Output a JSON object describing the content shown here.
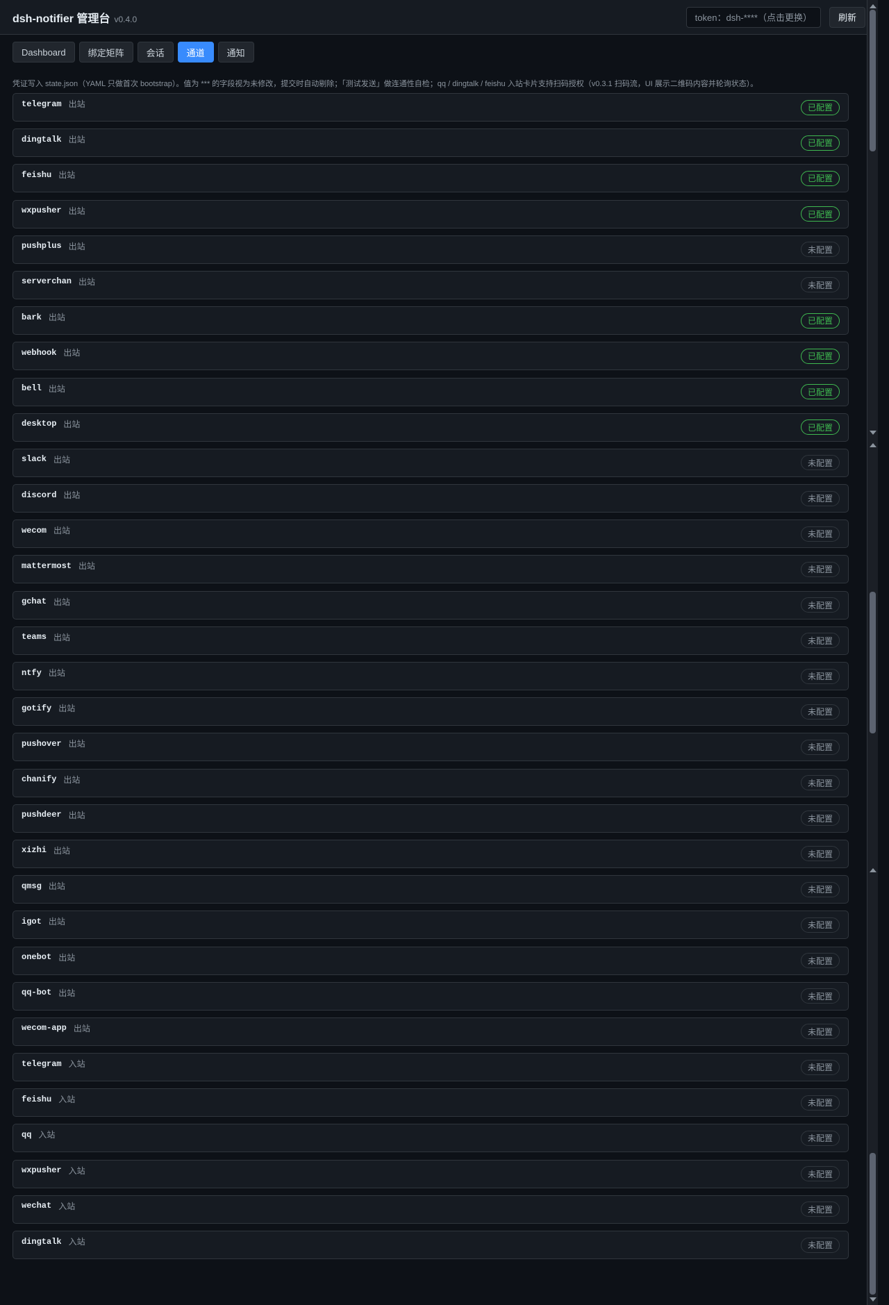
{
  "header": {
    "title": "dsh-notifier 管理台",
    "version": "v0.4.0",
    "token_label": "token：dsh-****（点击更换）",
    "refresh_label": "刷新"
  },
  "tabs": [
    {
      "label": "Dashboard",
      "active": false
    },
    {
      "label": "绑定矩阵",
      "active": false
    },
    {
      "label": "会话",
      "active": false
    },
    {
      "label": "通道",
      "active": true
    },
    {
      "label": "通知",
      "active": false
    }
  ],
  "note": "凭证写入 state.json（YAML 只做首次 bootstrap）。值为 *** 的字段视为未修改，提交时自动剔除；「测试发送」做连通性自检；qq / dingtalk / feishu 入站卡片支持扫码授权（v0.3.1 扫码流，UI 展示二维码内容并轮询状态）。",
  "status_labels": {
    "configured": "已配置",
    "not_configured": "未配置"
  },
  "colors": {
    "accent": "#388bfd",
    "configured": "#3fb950",
    "background": "#0d1117"
  },
  "channels": [
    {
      "name": "telegram",
      "direction": "出站",
      "configured": true
    },
    {
      "name": "dingtalk",
      "direction": "出站",
      "configured": true
    },
    {
      "name": "feishu",
      "direction": "出站",
      "configured": true
    },
    {
      "name": "wxpusher",
      "direction": "出站",
      "configured": true
    },
    {
      "name": "pushplus",
      "direction": "出站",
      "configured": false
    },
    {
      "name": "serverchan",
      "direction": "出站",
      "configured": false
    },
    {
      "name": "bark",
      "direction": "出站",
      "configured": true
    },
    {
      "name": "webhook",
      "direction": "出站",
      "configured": true
    },
    {
      "name": "bell",
      "direction": "出站",
      "configured": true
    },
    {
      "name": "desktop",
      "direction": "出站",
      "configured": true
    },
    {
      "name": "slack",
      "direction": "出站",
      "configured": false
    },
    {
      "name": "discord",
      "direction": "出站",
      "configured": false
    },
    {
      "name": "wecom",
      "direction": "出站",
      "configured": false
    },
    {
      "name": "mattermost",
      "direction": "出站",
      "configured": false
    },
    {
      "name": "gchat",
      "direction": "出站",
      "configured": false
    },
    {
      "name": "teams",
      "direction": "出站",
      "configured": false
    },
    {
      "name": "ntfy",
      "direction": "出站",
      "configured": false
    },
    {
      "name": "gotify",
      "direction": "出站",
      "configured": false
    },
    {
      "name": "pushover",
      "direction": "出站",
      "configured": false
    },
    {
      "name": "chanify",
      "direction": "出站",
      "configured": false
    },
    {
      "name": "pushdeer",
      "direction": "出站",
      "configured": false
    },
    {
      "name": "xizhi",
      "direction": "出站",
      "configured": false
    },
    {
      "name": "qmsg",
      "direction": "出站",
      "configured": false
    },
    {
      "name": "igot",
      "direction": "出站",
      "configured": false
    },
    {
      "name": "onebot",
      "direction": "出站",
      "configured": false
    },
    {
      "name": "qq-bot",
      "direction": "出站",
      "configured": false
    },
    {
      "name": "wecom-app",
      "direction": "出站",
      "configured": false
    },
    {
      "name": "telegram",
      "direction": "入站",
      "configured": false
    },
    {
      "name": "feishu",
      "direction": "入站",
      "configured": false
    },
    {
      "name": "qq",
      "direction": "入站",
      "configured": false
    },
    {
      "name": "wxpusher",
      "direction": "入站",
      "configured": false
    },
    {
      "name": "wechat",
      "direction": "入站",
      "configured": false
    },
    {
      "name": "dingtalk",
      "direction": "入站",
      "configured": false
    }
  ]
}
